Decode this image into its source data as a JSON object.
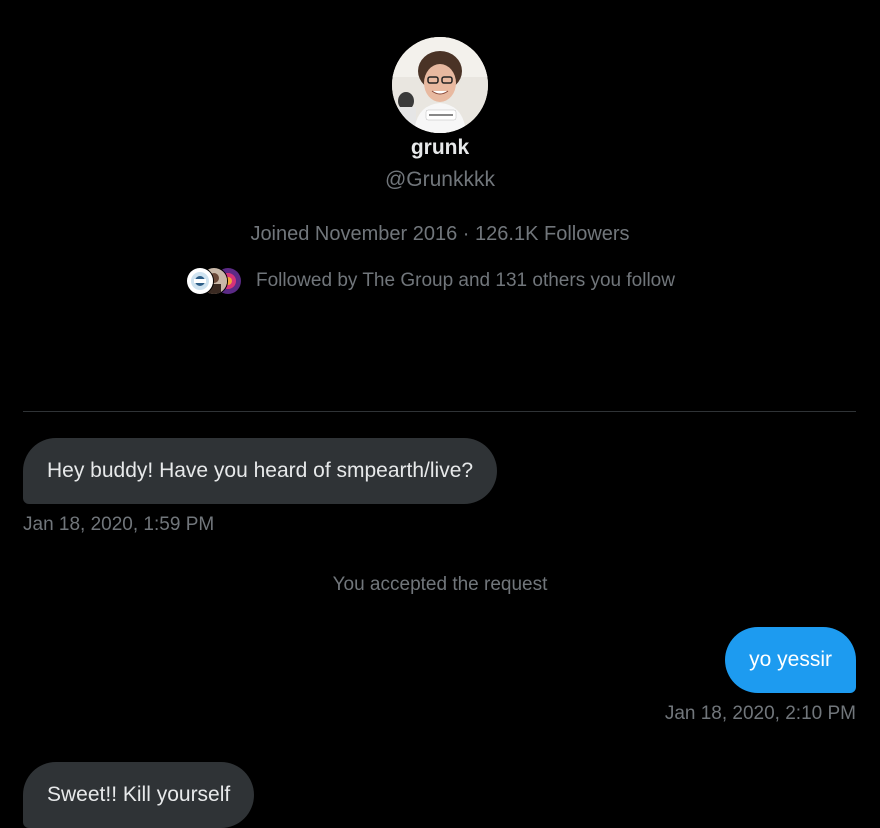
{
  "profile": {
    "avatar_icon": "user-photo",
    "display_name": "grunk",
    "handle": "@Grunkkkk",
    "joined": "Joined November 2016",
    "separator": "·",
    "followers": "126.1K Followers",
    "followed_by": "Followed by The Group and 131 others you follow"
  },
  "messages": [
    {
      "direction": "in",
      "text": "Hey buddy! Have you heard of smpearth/live?",
      "timestamp": "Jan 18, 2020, 1:59 PM"
    },
    {
      "system": "You accepted the request"
    },
    {
      "direction": "out",
      "text": "yo yessir",
      "timestamp": "Jan 18, 2020, 2:10 PM"
    },
    {
      "direction": "in",
      "text": "Sweet!! Kill yourself"
    }
  ],
  "colors": {
    "background": "#000000",
    "incoming_bubble": "#2f3336",
    "outgoing_bubble": "#1d9bf0",
    "muted_text": "#71767b"
  }
}
